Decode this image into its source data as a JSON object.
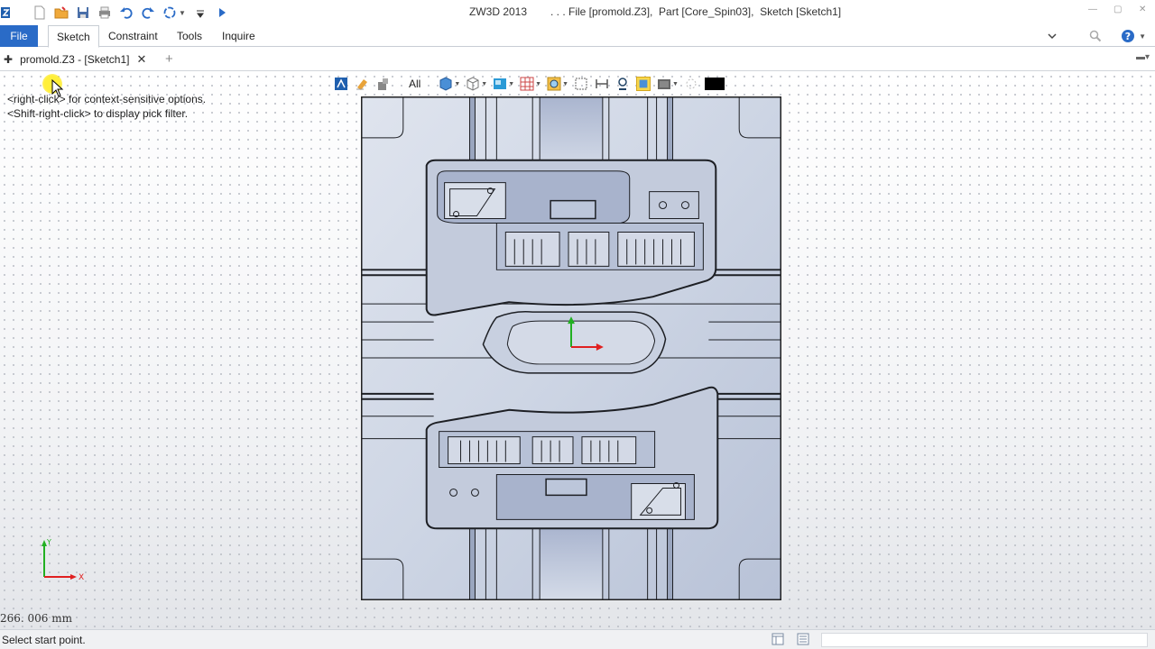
{
  "window": {
    "app_title": "ZW3D 2013",
    "doc_title": ". . . File [promold.Z3],  Part [Core_Spin03],  Sketch [Sketch1]"
  },
  "menu": {
    "file": "File",
    "tabs": [
      "Sketch",
      "Constraint",
      "Tools",
      "Inquire"
    ]
  },
  "doc_tab": {
    "label": "promold.Z3 - [Sketch1]",
    "close": "✕",
    "add": "+"
  },
  "hints": {
    "line1": "<right-click> for context-sensitive options.",
    "line2": "<Shift-right-click> to display pick filter."
  },
  "view_toolbar": {
    "filter_label": "All"
  },
  "triad": {
    "x_label": "X",
    "y_label": "Y"
  },
  "coordinate_readout": "266. 006 mm",
  "status": {
    "prompt": "Select start point."
  },
  "colors": {
    "file_menu_bg": "#2a6bc7",
    "model_fill": "#c6cfdf",
    "model_line": "#1d1f24",
    "axis_x": "#e02020",
    "axis_y": "#22b022"
  }
}
